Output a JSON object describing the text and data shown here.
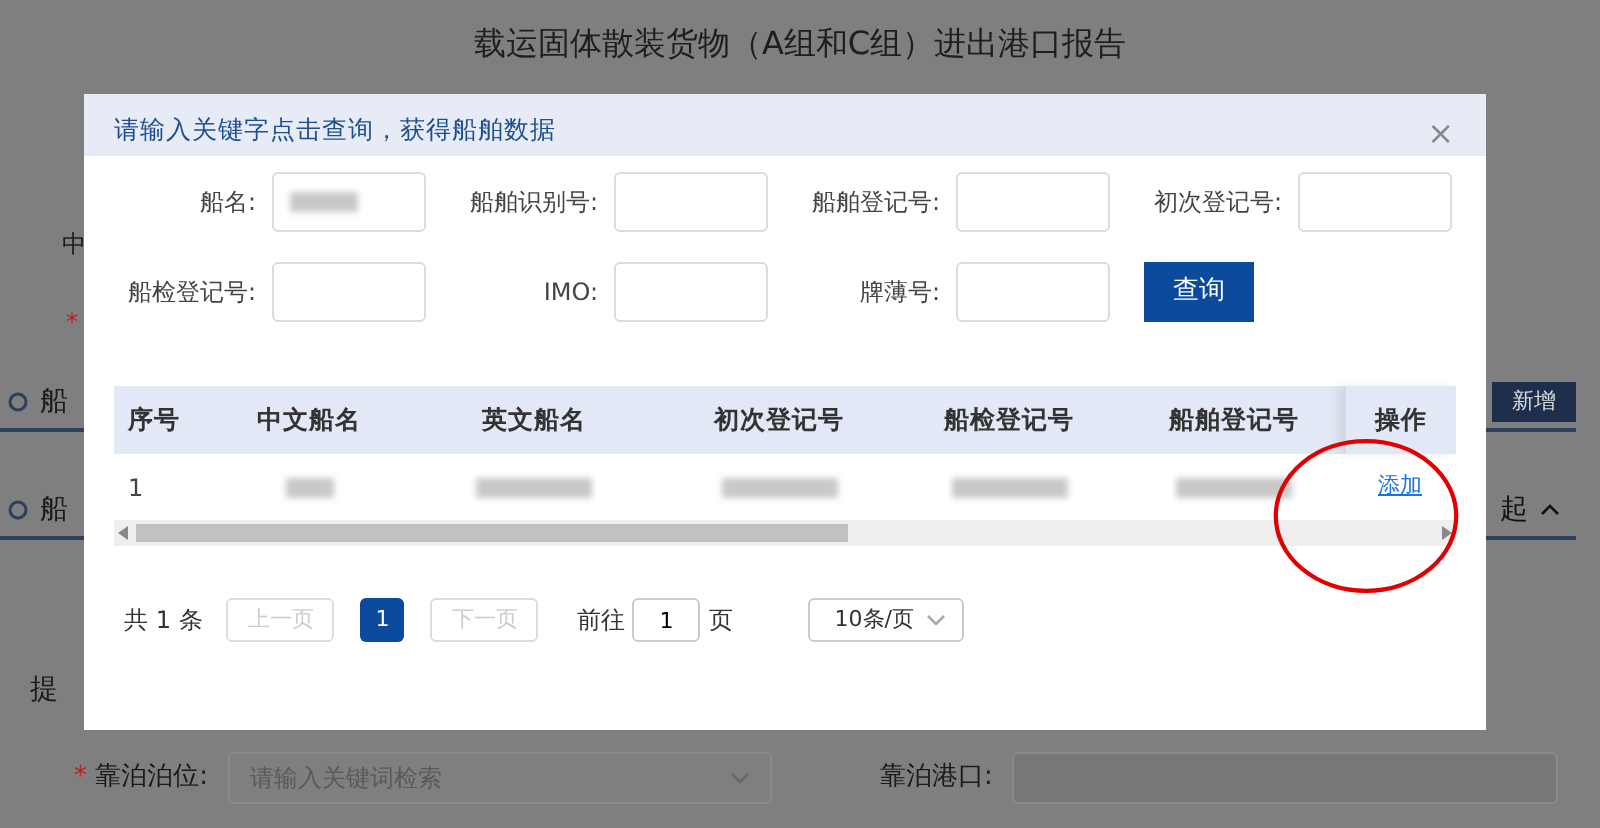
{
  "page": {
    "title": "载运固体散装货物（A组和C组）进出港口报告",
    "cut_label": "中",
    "required_mark": "*",
    "sections": [
      {
        "label": "船",
        "action": {
          "kind": "button",
          "label": "新增"
        }
      },
      {
        "label": "船",
        "action": {
          "kind": "toggle",
          "label": "起",
          "expanded": true
        }
      }
    ],
    "submit_label": "提",
    "fields": [
      {
        "label": "靠泊泊位:",
        "required": true,
        "kind": "select",
        "placeholder": "请输入关键词检索"
      },
      {
        "label": "靠泊港口:",
        "required": false,
        "kind": "text"
      }
    ]
  },
  "dialog": {
    "title": "请输入关键字点击查询，获得船舶数据",
    "close": "×",
    "filters": [
      {
        "label": "船名:",
        "redacted": true
      },
      {
        "label": "船舶识别号:",
        "redacted": false
      },
      {
        "label": "船舶登记号:",
        "redacted": false
      },
      {
        "label": "初次登记号:",
        "redacted": false
      },
      {
        "label": "船检登记号:",
        "redacted": false
      },
      {
        "label": "IMO:",
        "redacted": false
      },
      {
        "label": "牌薄号:",
        "redacted": false
      }
    ],
    "search_button": "查询",
    "table": {
      "columns": [
        "序号",
        "中文船名",
        "英文船名",
        "初次登记号",
        "船检登记号",
        "船舶登记号",
        "操作"
      ],
      "rows": [
        {
          "cells": [
            {
              "text": "1",
              "redacted": false
            },
            {
              "redacted": true
            },
            {
              "redacted": true
            },
            {
              "redacted": true
            },
            {
              "redacted": true
            },
            {
              "redacted": true
            }
          ],
          "action": "添加",
          "annotated": true
        }
      ]
    },
    "pagination": {
      "total_prefix": "共",
      "total": "1",
      "total_suffix": "条",
      "prev": "上一页",
      "pages": [
        {
          "label": "1",
          "selected": true
        }
      ],
      "next": "下一页",
      "goto_label": "前往",
      "goto_value": "1",
      "goto_suffix": "页",
      "page_size": "10条/页"
    }
  }
}
